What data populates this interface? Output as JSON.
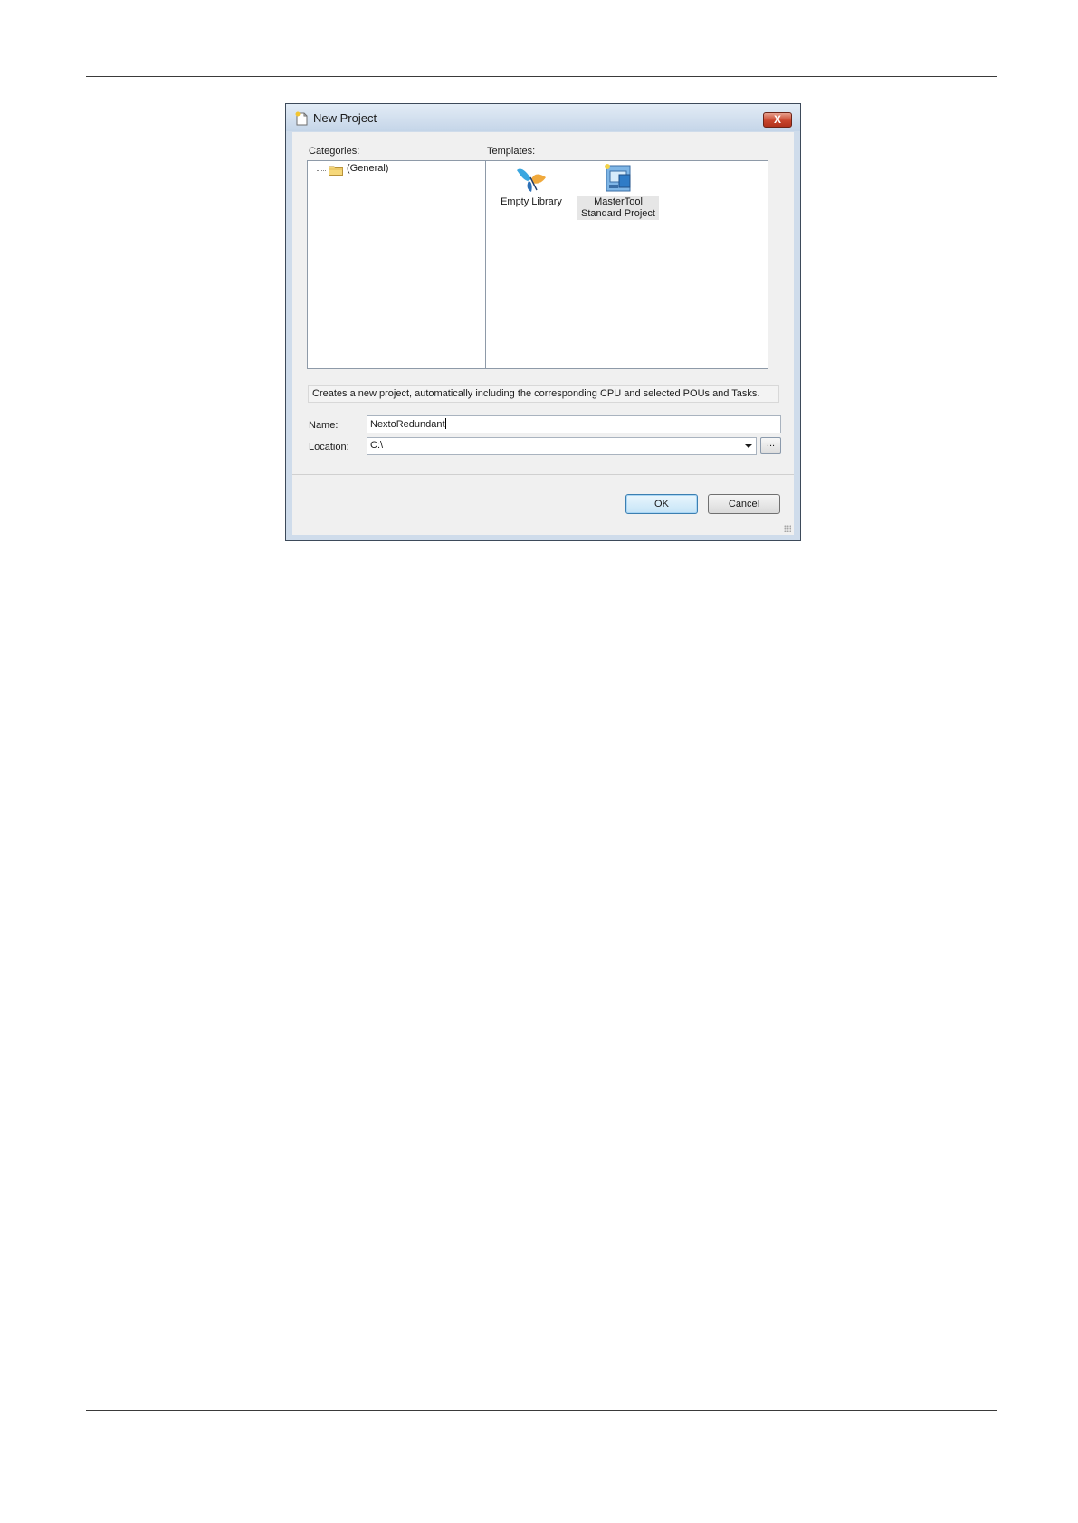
{
  "dialog": {
    "title": "New Project",
    "close_label": "X",
    "categories_label": "Categories:",
    "templates_label": "Templates:",
    "categories": [
      {
        "label": "(General)",
        "icon": "folder-icon"
      }
    ],
    "templates": [
      {
        "label": "Empty Library",
        "icon": "library-icon",
        "selected": false
      },
      {
        "label_line1": "MasterTool",
        "label_line2": "Standard Project",
        "icon": "project-icon",
        "selected": true
      }
    ],
    "description": "Creates a new project, automatically including the corresponding CPU and selected POUs and Tasks.",
    "name_label": "Name:",
    "name_value": "NextoRedundant",
    "location_label": "Location:",
    "location_value": "C:\\",
    "browse_label": "...",
    "ok_label": "OK",
    "cancel_label": "Cancel"
  },
  "colors": {
    "title_gradient_top": "#e3ecf6",
    "close_button": "#c9452c",
    "client_background": "#f0f0f0",
    "default_button_border": "#3c7fb1"
  }
}
